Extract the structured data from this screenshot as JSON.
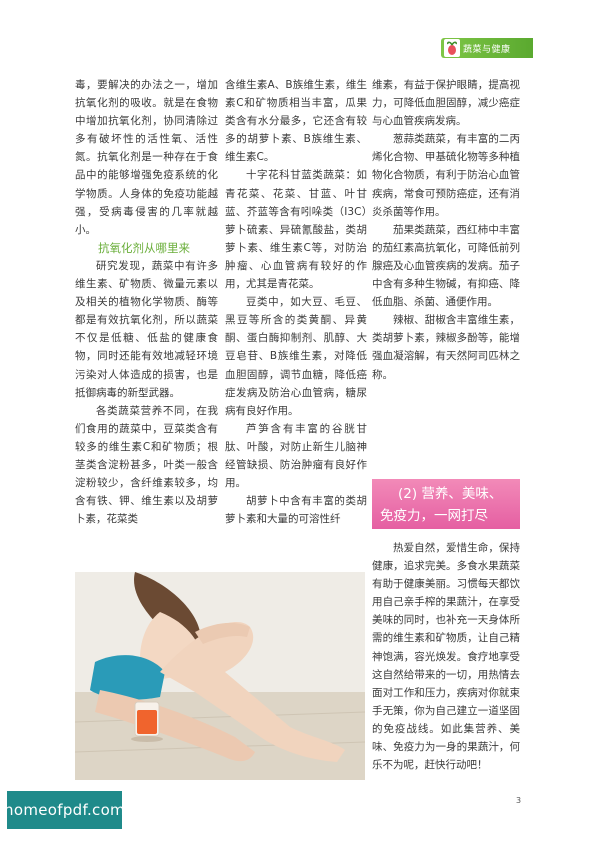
{
  "header": {
    "label": "蔬菜与健康",
    "accent": "#6aae3a"
  },
  "column1": {
    "p1": "毒，要解决的办法之一，增加抗氧化剂的吸收。就是在食物中增加抗氧化剂，协同清除过多有破坏性的活性氧、活性氮。抗氧化剂是一种存在于食品中的能够增强免疫系统的化学物质。人身体的免疫功能越强，受病毒侵害的几率就越小。",
    "subhead": "抗氧化剂从哪里来",
    "p2": "研究发现，蔬菜中有许多维生素、矿物质、微量元素以及相关的植物化学物质、酶等都是有效抗氧化剂，所以蔬菜不仅是低糖、低盐的健康食物，同时还能有效地减轻环境污染对人体造成的损害，也是抵御病毒的新型武器。",
    "p3": "各类蔬菜营养不同，在我们食用的蔬菜中，豆菜类含有较多的维生素C和矿物质；根茎类含淀粉甚多，叶类一般含淀粉较少，含纤维素较多，均含有铁、钾、维生素以及胡萝卜素，花菜类"
  },
  "column2": {
    "p1": "含维生素A、B族维生素，维生素C和矿物质相当丰富，瓜果类含有水分最多，它还含有较多的胡萝卜素、B族维生素、维生素C。",
    "p2": "十字花科甘蓝类蔬菜：如青花菜、花菜、甘蓝、叶甘蓝、芥蓝等含有吲哚类（I3C）萝卜硫素、异硫氰酸盐，类胡萝卜素、维生素C等，对防治肿瘤、心血管病有较好的作用，尤其是青花菜。",
    "p3": "豆类中，如大豆、毛豆、黑豆等所含的类黄酮、异黄酮、蛋白酶抑制剂、肌醇、大豆皂苷、B族维生素，对降低血胆固醇，调节血糖，降低癌症发病及防治心血管病，糖尿病有良好作用。",
    "p4": "芦笋含有丰富的谷胱甘肽、叶酸，对防止新生儿脑神经管缺损、防治肿瘤有良好作用。",
    "p5": "胡萝卜中含有丰富的类胡萝卜素和大量的可溶性纤"
  },
  "column3": {
    "p1": "维素，有益于保护眼睛，提高视力，可降低血胆固醇，减少癌症与心血管疾病发病。",
    "p2": "葱蒜类蔬菜，有丰富的二丙烯化合物、甲基硫化物等多种植物化合物质，有利于防治心血管疾病，常食可预防癌症，还有消炎杀菌等作用。",
    "p3": "茄果类蔬菜，西红柿中丰富的茄红素高抗氧化，可降低前列腺癌及心血管疾病的发病。茄子中含有多种生物碱，有抑癌、降低血脂、杀菌、通便作用。",
    "p4": "辣椒、甜椒含丰富维生素，类胡萝卜素，辣椒多酚等，能增强血凝溶解，有天然阿司匹林之称。",
    "banner_line1": "(2) 营养、美味、",
    "banner_line2": "免疫力，一网打尽",
    "p5": "热爱自然，爱惜生命，保持健康，追求完美。多食水果蔬菜有助于健康美丽。习惯每天都饮用自己亲手榨的果蔬汁，在享受美味的同时，也补充一天身体所需的维生素和矿物质，让自己精神饱满，容光焕发。食疗地享受这自然给带来的一切，用热情去面对工作和压力，疾病对你就束手无策，你为自己建立一道坚固的免疫战线。如此集营养、美味、免疫力为一身的果蔬汁，何乐不为呢，赶快行动吧！"
  },
  "watermark": "homeofpdf.com",
  "page_number": "3"
}
